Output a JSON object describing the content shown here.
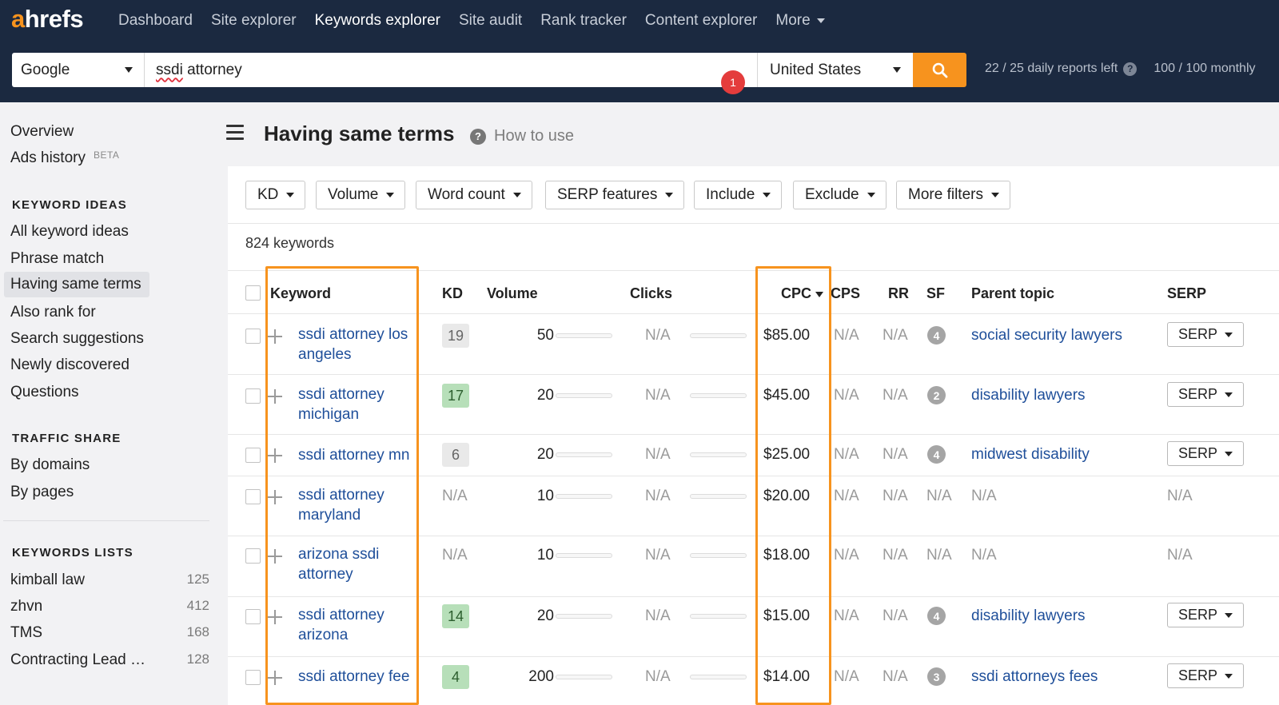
{
  "topbar": {
    "logo_a": "a",
    "logo_rest": "hrefs",
    "nav": [
      "Dashboard",
      "Site explorer",
      "Keywords explorer",
      "Site audit",
      "Rank tracker",
      "Content explorer"
    ],
    "more_label": "More",
    "engine": "Google",
    "query_misspelled": "ssdi",
    "query_rest": " attorney",
    "notification_count": "1",
    "country": "United States",
    "reports_daily": "22 / 25 daily reports left",
    "reports_monthly": "100 / 100 monthly",
    "help_glyph": "?"
  },
  "sidebar": {
    "overview": "Overview",
    "ads_history": "Ads history",
    "beta": "BETA",
    "keyword_ideas_heading": "KEYWORD IDEAS",
    "keyword_ideas": [
      "All keyword ideas",
      "Phrase match",
      "Having same terms",
      "Also rank for",
      "Search suggestions",
      "Newly discovered",
      "Questions"
    ],
    "traffic_share_heading": "TRAFFIC SHARE",
    "traffic_share": [
      "By domains",
      "By pages"
    ],
    "keywords_lists_heading": "KEYWORDS LISTS",
    "keywords_lists": [
      {
        "name": "kimball law",
        "count": "125"
      },
      {
        "name": "zhvn",
        "count": "412"
      },
      {
        "name": "TMS",
        "count": "168"
      },
      {
        "name": "Contracting Lead …",
        "count": "128"
      }
    ]
  },
  "main": {
    "title": "Having same terms",
    "how_to_use": "How to use",
    "help_glyph": "?",
    "filters": [
      "KD",
      "Volume",
      "Word count",
      "SERP features",
      "Include",
      "Exclude",
      "More filters"
    ],
    "keyword_count": "824 keywords",
    "columns": {
      "keyword": "Keyword",
      "kd": "KD",
      "volume": "Volume",
      "clicks": "Clicks",
      "cpc": "CPC",
      "cps": "CPS",
      "rr": "RR",
      "sf": "SF",
      "parent_topic": "Parent topic",
      "serp": "SERP"
    },
    "rows": [
      {
        "keyword": "ssdi attorney los angeles",
        "kd": "19",
        "volume": "50",
        "clicks": "N/A",
        "cpc": "$85.00",
        "cps": "N/A",
        "rr": "N/A",
        "sf": "4",
        "parent_topic": "social security lawyers",
        "serp": "SERP"
      },
      {
        "keyword": "ssdi attorney michigan",
        "kd": "17",
        "volume": "20",
        "clicks": "N/A",
        "cpc": "$45.00",
        "cps": "N/A",
        "rr": "N/A",
        "sf": "2",
        "parent_topic": "disability lawyers",
        "serp": "SERP"
      },
      {
        "keyword": "ssdi attorney mn",
        "kd": "6",
        "volume": "20",
        "clicks": "N/A",
        "cpc": "$25.00",
        "cps": "N/A",
        "rr": "N/A",
        "sf": "4",
        "parent_topic": "midwest disability",
        "serp": "SERP"
      },
      {
        "keyword": "ssdi attorney maryland",
        "kd": "N/A",
        "volume": "10",
        "clicks": "N/A",
        "cpc": "$20.00",
        "cps": "N/A",
        "rr": "N/A",
        "sf": "N/A",
        "parent_topic": "N/A",
        "serp": "N/A"
      },
      {
        "keyword": "arizona ssdi attorney",
        "kd": "N/A",
        "volume": "10",
        "clicks": "N/A",
        "cpc": "$18.00",
        "cps": "N/A",
        "rr": "N/A",
        "sf": "N/A",
        "parent_topic": "N/A",
        "serp": "N/A"
      },
      {
        "keyword": "ssdi attorney arizona",
        "kd": "14",
        "volume": "20",
        "clicks": "N/A",
        "cpc": "$15.00",
        "cps": "N/A",
        "rr": "N/A",
        "sf": "4",
        "parent_topic": "disability lawyers",
        "serp": "SERP"
      },
      {
        "keyword": "ssdi attorney fee",
        "kd": "4",
        "volume": "200",
        "clicks": "N/A",
        "cpc": "$14.00",
        "cps": "N/A",
        "rr": "N/A",
        "sf": "3",
        "parent_topic": "ssdi attorneys fees",
        "serp": "SERP"
      }
    ]
  },
  "colors": {
    "topbar_bg": "#1b2940",
    "accent_orange": "#f7931e",
    "link_blue": "#1f4f9a",
    "kd_green": "#b7dfb9",
    "kd_grey": "#e9e9e9",
    "notification_red": "#e43c3c"
  },
  "icons": {
    "search_button": "search-icon",
    "menu": "hamburger-menu-icon",
    "help": "question-circle-icon",
    "add_keyword": "plus-icon",
    "dropdown": "chevron-down-icon",
    "sort": "sort-descending-icon"
  }
}
